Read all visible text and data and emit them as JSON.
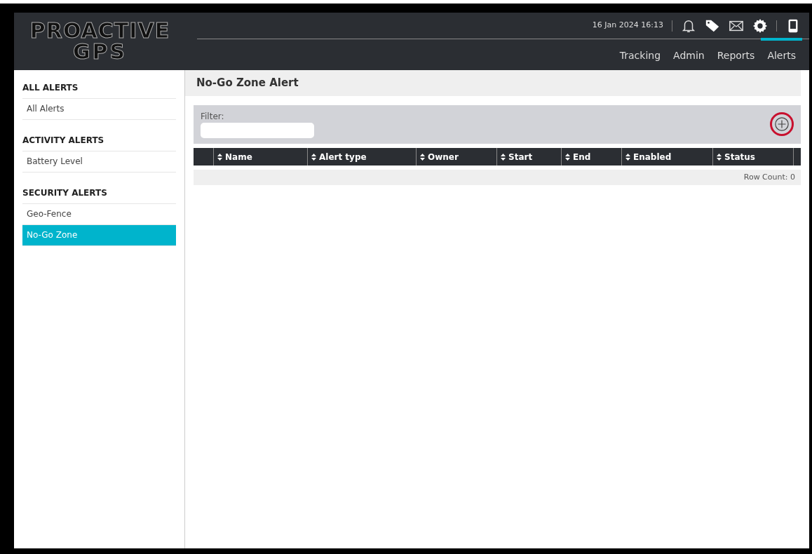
{
  "logo": {
    "line_1": "PROACTIVE",
    "line_2": "GPS"
  },
  "header": {
    "datetime": "16 Jan 2024 16:13"
  },
  "nav_tabs": [
    {
      "label": "Tracking",
      "selected": false
    },
    {
      "label": "Admin",
      "selected": false
    },
    {
      "label": "Reports",
      "selected": false
    },
    {
      "label": "Alerts",
      "selected": true
    }
  ],
  "sidebar": {
    "sections": [
      {
        "title": "ALL ALERTS",
        "items": [
          {
            "label": "All Alerts",
            "selected": false
          }
        ]
      },
      {
        "title": "ACTIVITY ALERTS",
        "items": [
          {
            "label": "Battery Level",
            "selected": false
          }
        ]
      },
      {
        "title": "SECURITY ALERTS",
        "items": [
          {
            "label": "Geo-Fence",
            "selected": false
          },
          {
            "label": "No-Go Zone",
            "selected": true
          }
        ]
      }
    ]
  },
  "page_title": "No-Go Zone Alert",
  "filter": {
    "label": "Filter:"
  },
  "add_button": {
    "highlighted": true
  },
  "table": {
    "columns": [
      "Name",
      "Alert type",
      "Owner",
      "Start",
      "End",
      "Enabled",
      "Status"
    ],
    "footer": "Row Count: 0"
  }
}
